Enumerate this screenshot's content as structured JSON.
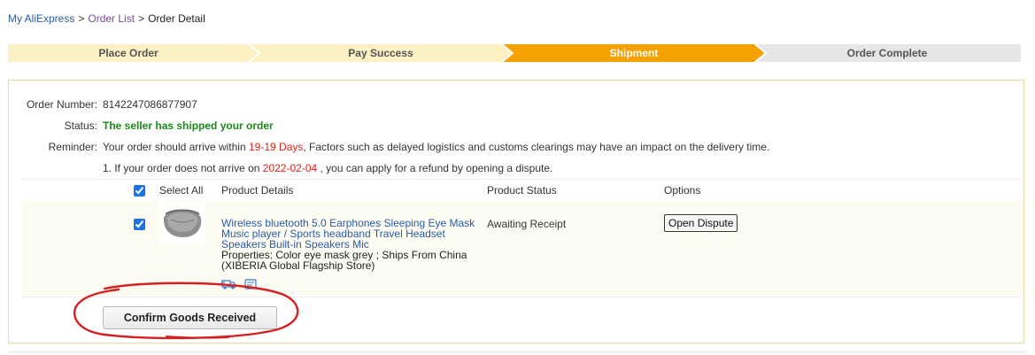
{
  "breadcrumb": {
    "items": [
      "My AliExpress",
      "Order List"
    ],
    "separator": ">",
    "current": "Order Detail"
  },
  "progress": {
    "steps": [
      "Place Order",
      "Pay Success",
      "Shipment",
      "Order Complete"
    ],
    "active_index": 2,
    "colors": {
      "done": "#fbf0c2",
      "active": "#f5a100",
      "pending": "#e6e6e6"
    }
  },
  "order": {
    "number_label": "Order Number:",
    "number": "8142247086877907",
    "status_label": "Status:",
    "status": "The seller has shipped your order",
    "reminder_label": "Reminder:",
    "reminder_pre": "Your order should arrive within",
    "reminder_days": "19-19 Days",
    "reminder_post": ", Factors such as delayed logistics and customs clearings may have an impact on the delivery time.",
    "note_pre": "1. If your order does not arrive on",
    "note_date": "2022-02-04",
    "note_post": ", you can apply for a refund by opening a dispute."
  },
  "table": {
    "select_all": "Select All",
    "headers": [
      "Product Details",
      "Product Status",
      "Options"
    ]
  },
  "product": {
    "title": "Wireless bluetooth 5.0 Earphones Sleeping Eye Mask Music player / Sports headband Travel Headset Speakers Built-in Speakers Mic",
    "properties": "Properties: Color eye mask grey    ; Ships From China",
    "store": "(XIBERIA Global Flagship Store)",
    "status": "Awaiting Receipt",
    "dispute_button": "Open Dispute"
  },
  "actions": {
    "confirm_button": "Confirm Goods Received"
  },
  "colors": {
    "link": "#2a5ba8",
    "status_green": "#1a8a1a",
    "highlight_red": "#e2231a",
    "annotation_red": "#d42020"
  }
}
